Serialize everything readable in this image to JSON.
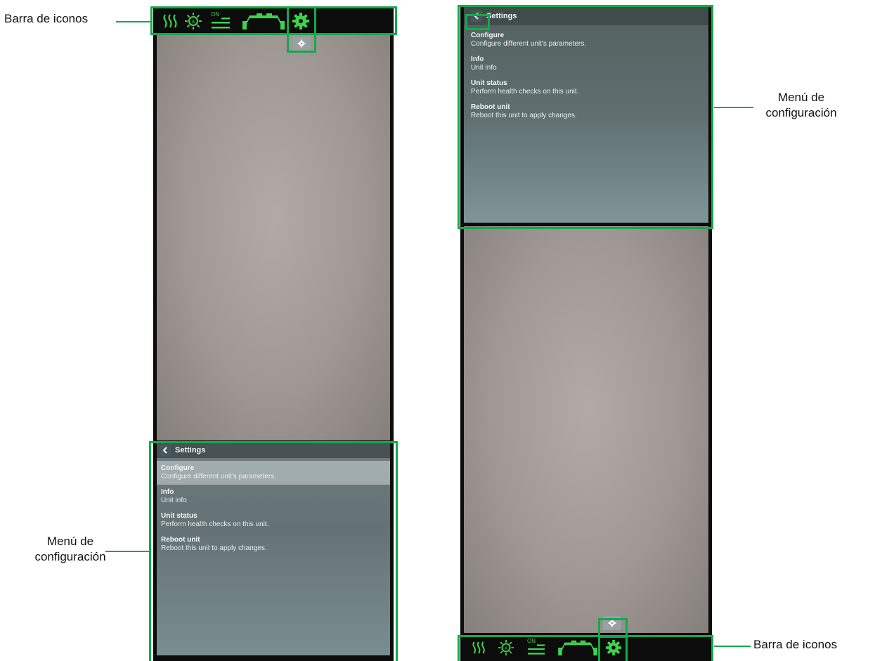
{
  "annotations": {
    "icon_bar": "Barra de iconos",
    "config_menu_line1": "Menú de",
    "config_menu_line2": "configuración"
  },
  "iconbar": {
    "on_label": "ON",
    "icons": [
      "heat-waves-icon",
      "auto-brightness-icon",
      "on-lines-icon",
      "boom-section-icon",
      "gear-icon"
    ]
  },
  "settings": {
    "title": "Settings",
    "items": [
      {
        "title": "Configure",
        "desc": "Configure different unit's parameters."
      },
      {
        "title": "Info",
        "desc": "Unit info"
      },
      {
        "title": "Unit status",
        "desc": "Perform health checks on this unit."
      },
      {
        "title": "Reboot unit",
        "desc": "Reboot this unit to apply changes."
      }
    ]
  },
  "colors": {
    "accent": "#14a94a",
    "icon_green": "#3fd24d",
    "bar": "#0c0c0c"
  }
}
